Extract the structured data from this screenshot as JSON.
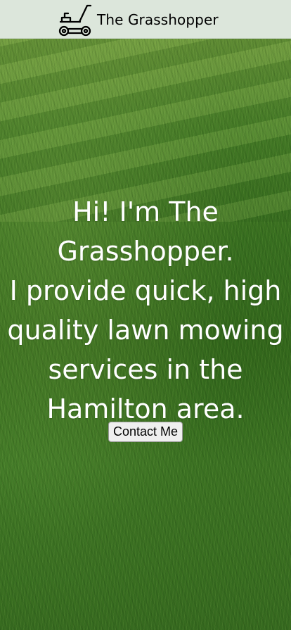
{
  "header": {
    "brand_name": "The Grasshopper",
    "logo_icon": "lawn-mower-icon"
  },
  "hero": {
    "lines": [
      "Hi! I'm The",
      "Grasshopper.",
      "I provide quick, high",
      "quality lawn mowing",
      "services in the",
      "Hamilton area."
    ],
    "contact_button": "Contact Me"
  },
  "colors": {
    "header_background": "#dce6db",
    "hero_text": "#ffffff",
    "grass": "#3f7a24"
  }
}
